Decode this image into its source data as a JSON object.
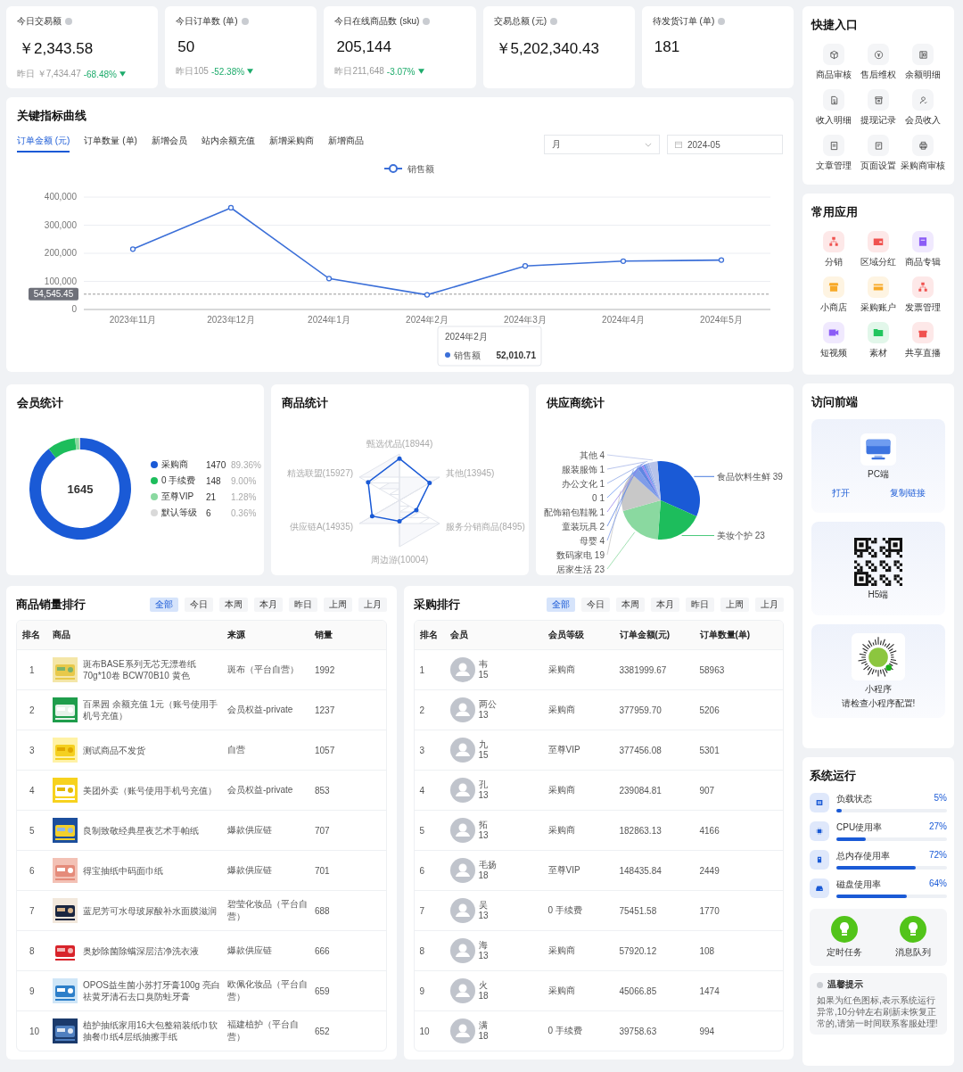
{
  "stats": [
    {
      "label": "今日交易额",
      "value": "￥2,343.58",
      "compare": "昨日 ￥7,434.47",
      "change": "-68.48%",
      "down": true
    },
    {
      "label": "今日订单数 (单)",
      "value": "50",
      "compare": "昨日105",
      "change": "-52.38%",
      "down": true
    },
    {
      "label": "今日在线商品数 (sku)",
      "value": "205,144",
      "compare": "昨日211,648",
      "change": "-3.07%",
      "down": true
    },
    {
      "label": "交易总额 (元)",
      "value": "￥5,202,340.43"
    },
    {
      "label": "待发货订单 (单)",
      "value": "181"
    }
  ],
  "key_metrics": {
    "title": "关键指标曲线",
    "tabs": [
      {
        "label": "订单金额 (元)",
        "selected": true
      },
      {
        "label": "订单数量 (单)",
        "selected": false
      },
      {
        "label": "新增会员",
        "selected": false
      },
      {
        "label": "站内余额充值",
        "selected": false
      },
      {
        "label": "新增采购商",
        "selected": false
      },
      {
        "label": "新增商品",
        "selected": false
      }
    ],
    "period_select": {
      "value": "月"
    },
    "date_field": {
      "value": "2024-05"
    },
    "chart_data": {
      "type": "line",
      "categories": [
        "2023年11月",
        "2023年12月",
        "2024年1月",
        "2024年2月",
        "2024年3月",
        "2024年4月",
        "2024年5月"
      ],
      "grid": true,
      "series": [
        {
          "name": "销售额",
          "color": "#3b6fd8",
          "marker": "circle",
          "values": [
            215000,
            362000,
            110000,
            52010.71,
            155000,
            172000,
            176000
          ]
        }
      ],
      "ylim": [
        0,
        400000
      ],
      "yticks": [
        {
          "value": 0,
          "label": "0"
        },
        {
          "value": 100000,
          "label": "100,000"
        },
        {
          "value": 200000,
          "label": "200,000"
        },
        {
          "value": 300000,
          "label": "300,000"
        },
        {
          "value": 400000,
          "label": "400,000"
        }
      ],
      "ref_lines": [
        {
          "axis": "y",
          "value": 54545.45,
          "label": "54,545.45"
        }
      ]
    },
    "tooltip": {
      "title": "2024年2月",
      "series": "销售额",
      "value": "52,010.71"
    }
  },
  "members": {
    "title": "会员统计",
    "total": "1645",
    "legend": [
      {
        "label": "采购商",
        "count": "1470",
        "percent": "89.36%",
        "color": "#1a5ad6"
      },
      {
        "label": "0 手续费",
        "count": "148",
        "percent": "9.00%",
        "color": "#1dbd5c"
      },
      {
        "label": "至尊VIP",
        "count": "21",
        "percent": "1.28%",
        "color": "#8ad9a0"
      },
      {
        "label": "默认等级",
        "count": "6",
        "percent": "0.36%",
        "color": "#d9d9d9"
      }
    ],
    "chart_data": {
      "type": "donut",
      "values": [
        89.36,
        9.0,
        1.28,
        0.36
      ]
    }
  },
  "product_stats": {
    "title": "商品统计",
    "axes": [
      "甄选优品(18944)",
      "精选联盟(15927)",
      "其他(13945)",
      "供应链A(14935)",
      "服务分销商品(8495)",
      "周边游(10004)"
    ]
  },
  "supplier_stats": {
    "title": "供应商统计",
    "chart_data": {
      "type": "pie",
      "categories": [
        "食品饮料生鲜 39",
        "美妆个护 23",
        "居家生活 23",
        "数码家电 19",
        "母婴 4",
        "童装玩具 2",
        "配饰箱包鞋靴 1",
        "0 1",
        "办公文化 1",
        "服装服饰 1",
        "其他 4"
      ],
      "values": [
        39,
        23,
        23,
        19,
        4,
        2,
        1,
        1,
        1,
        1,
        4
      ]
    }
  },
  "sales_ranking": {
    "title": "商品销量排行",
    "filters": [
      {
        "label": "全部",
        "selected": true
      },
      {
        "label": "今日",
        "selected": false
      },
      {
        "label": "本周",
        "selected": false
      },
      {
        "label": "本月",
        "selected": false
      },
      {
        "label": "昨日",
        "selected": false
      },
      {
        "label": "上周",
        "selected": false
      },
      {
        "label": "上月",
        "selected": false
      }
    ],
    "columns": [
      "排名",
      "商品",
      "来源",
      "销量"
    ],
    "rows": [
      {
        "rank": "1",
        "product": "斑布BASE系列无芯无漂卷纸70g*10卷 BCW70B10 黄色",
        "source": "斑布（平台自营）",
        "sales": "1992"
      },
      {
        "rank": "2",
        "product": "百果园 余额充值 1元（账号使用手机号充值）",
        "source": "会员权益-private",
        "sales": "1237"
      },
      {
        "rank": "3",
        "product": "测试商品不发货",
        "source": "自营",
        "sales": "1057"
      },
      {
        "rank": "4",
        "product": "美团外卖（账号使用手机号充值）",
        "source": "会员权益-private",
        "sales": "853"
      },
      {
        "rank": "5",
        "product": "良制致敬经典星夜艺术手帕纸",
        "source": "爆款供应链",
        "sales": "707"
      },
      {
        "rank": "6",
        "product": "得宝抽纸中码面巾纸",
        "source": "爆款供应链",
        "sales": "701"
      },
      {
        "rank": "7",
        "product": "蓝尼芳可水母玻尿酸补水面膜滋润",
        "source": "碧莹化妆品（平台自营）",
        "sales": "688"
      },
      {
        "rank": "8",
        "product": "奥妙除菌除螨深层洁净洗衣液",
        "source": "爆款供应链",
        "sales": "666"
      },
      {
        "rank": "9",
        "product": "OPOS益生菌小苏打牙膏100g 亮白祛黄牙清石去口臭防蛀牙膏",
        "source": "欧佩化妆品（平台自营）",
        "sales": "659"
      },
      {
        "rank": "10",
        "product": "植护抽纸家用16大包整箱装纸巾软抽餐巾纸4层纸抽擦手纸",
        "source": "福建植护（平台自营）",
        "sales": "652"
      }
    ]
  },
  "purchase_ranking": {
    "title": "采购排行",
    "filters": [
      {
        "label": "全部",
        "selected": true
      },
      {
        "label": "今日",
        "selected": false
      },
      {
        "label": "本周",
        "selected": false
      },
      {
        "label": "本月",
        "selected": false
      },
      {
        "label": "昨日",
        "selected": false
      },
      {
        "label": "上周",
        "selected": false
      },
      {
        "label": "上月",
        "selected": false
      }
    ],
    "columns": [
      "排名",
      "会员",
      "会员等级",
      "订单金额(元)",
      "订单数量(单)"
    ],
    "rows": [
      {
        "rank": "1",
        "name": "韦",
        "phone": "15",
        "level": "采购商",
        "amount": "3381999.67",
        "orders": "58963"
      },
      {
        "rank": "2",
        "name": "两公",
        "phone": "13",
        "level": "采购商",
        "amount": "377959.70",
        "orders": "5206"
      },
      {
        "rank": "3",
        "name": "九",
        "phone": "15",
        "level": "至尊VIP",
        "amount": "377456.08",
        "orders": "5301"
      },
      {
        "rank": "4",
        "name": "孔",
        "phone": "13",
        "level": "采购商",
        "amount": "239084.81",
        "orders": "907"
      },
      {
        "rank": "5",
        "name": "拓",
        "phone": "13",
        "level": "采购商",
        "amount": "182863.13",
        "orders": "4166"
      },
      {
        "rank": "6",
        "name": "毛扬",
        "phone": "18",
        "level": "至尊VIP",
        "amount": "148435.84",
        "orders": "2449"
      },
      {
        "rank": "7",
        "name": "吴",
        "phone": "13",
        "level": "0 手续费",
        "amount": "75451.58",
        "orders": "1770"
      },
      {
        "rank": "8",
        "name": "海",
        "phone": "13",
        "level": "采购商",
        "amount": "57920.12",
        "orders": "108"
      },
      {
        "rank": "9",
        "name": "火",
        "phone": "18",
        "level": "采购商",
        "amount": "45066.85",
        "orders": "1474"
      },
      {
        "rank": "10",
        "name": "满",
        "phone": "18",
        "level": "0 手续费",
        "amount": "39758.63",
        "orders": "994"
      }
    ]
  },
  "quick_entry": {
    "title": "快捷入口",
    "items": [
      {
        "label": "商品审核"
      },
      {
        "label": "售后维权"
      },
      {
        "label": "余额明细"
      },
      {
        "label": "收入明细"
      },
      {
        "label": "提现记录"
      },
      {
        "label": "会员收入"
      },
      {
        "label": "文章管理"
      },
      {
        "label": "页面设置"
      },
      {
        "label": "采购商审核"
      }
    ]
  },
  "common_apps": {
    "title": "常用应用",
    "items": [
      {
        "label": "分销",
        "color": "#f0524f"
      },
      {
        "label": "区域分红",
        "color": "#f0524f"
      },
      {
        "label": "商品专辑",
        "color": "#8b5cf6"
      },
      {
        "label": "小商店",
        "color": "#f7a928"
      },
      {
        "label": "采购账户",
        "color": "#f7a928"
      },
      {
        "label": "发票管理",
        "color": "#f0524f"
      },
      {
        "label": "短视频",
        "color": "#8b5cf6"
      },
      {
        "label": "素材",
        "color": "#22c55e"
      },
      {
        "label": "共享直播",
        "color": "#f0524f"
      }
    ]
  },
  "frontend": {
    "title": "访问前端",
    "pc": {
      "label": "PC端",
      "links": [
        "打开",
        "复制链接"
      ]
    },
    "h5": {
      "label": "H5端"
    },
    "mini_program": {
      "label": "小程序",
      "note": "请检查小程序配置!"
    }
  },
  "system": {
    "title": "系统运行",
    "metrics": [
      {
        "label": "负载状态",
        "reading": "5%",
        "level": 0.05
      },
      {
        "label": "CPU使用率",
        "reading": "27%",
        "level": 0.27
      },
      {
        "label": "总内存使用率",
        "reading": "72%",
        "level": 0.72
      },
      {
        "label": "磁盘使用率",
        "reading": "64%",
        "level": 0.64
      }
    ],
    "services": [
      {
        "label": "定时任务",
        "ok": true
      },
      {
        "label": "消息队列",
        "ok": true
      }
    ],
    "tip": {
      "title": "温馨提示",
      "text": "如果为红色图标,表示系统运行异常,10分钟左右刷新未恢复正常的,请第一时间联系客服处理!"
    }
  }
}
